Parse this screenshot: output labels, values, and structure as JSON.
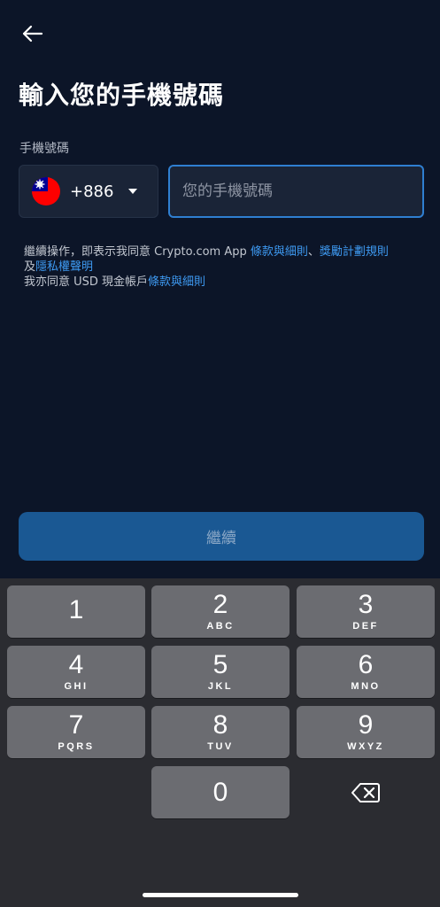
{
  "page": {
    "title": "輸入您的手機號碼",
    "phone_label": "手機號碼"
  },
  "country": {
    "code": "+886",
    "flag_colors": {
      "red": "#fe0000",
      "blue": "#000095",
      "white": "#ffffff"
    }
  },
  "phone_input": {
    "placeholder": "您的手機號碼",
    "value": ""
  },
  "terms": {
    "line1_text": "繼續操作，即表示我同意 Crypto.com App ",
    "line1_link1": "條款與細則",
    "line1_sep": "、",
    "line1_link2": "獎勵計劃規則",
    "line2_prefix": "及",
    "line2_link": "隱私權聲明",
    "line3_text": "我亦同意 USD 現金帳戶",
    "line3_link": "條款與細則"
  },
  "continue_button": {
    "label": "繼續"
  },
  "keypad": {
    "keys": [
      {
        "digit": "1",
        "letters": ""
      },
      {
        "digit": "2",
        "letters": "ABC"
      },
      {
        "digit": "3",
        "letters": "DEF"
      },
      {
        "digit": "4",
        "letters": "GHI"
      },
      {
        "digit": "5",
        "letters": "JKL"
      },
      {
        "digit": "6",
        "letters": "MNO"
      },
      {
        "digit": "7",
        "letters": "PQRS"
      },
      {
        "digit": "8",
        "letters": "TUV"
      },
      {
        "digit": "9",
        "letters": "WXYZ"
      }
    ],
    "zero": {
      "digit": "0"
    },
    "delete_icon": "backspace-icon"
  },
  "colors": {
    "background": "#0c1528",
    "accent": "#2f7fd1",
    "link": "#3e9af2",
    "button_disabled": "#1a5893",
    "keyboard_bg": "#2b2c31",
    "key_bg": "#6b6c71"
  }
}
